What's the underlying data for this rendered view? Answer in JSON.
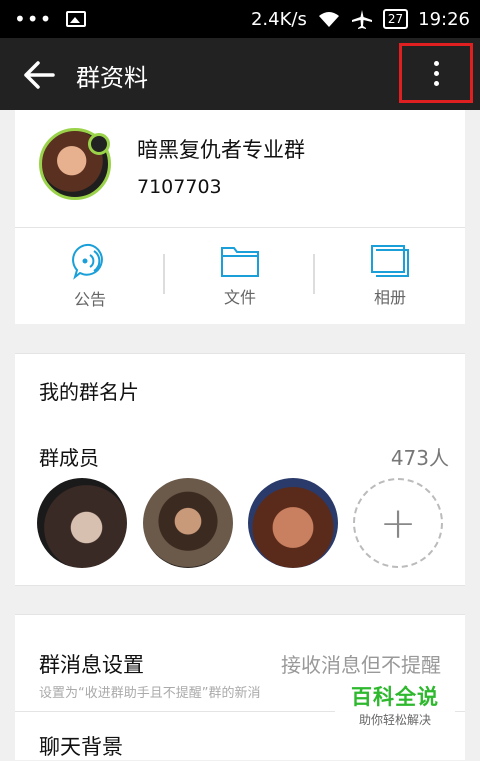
{
  "status_bar": {
    "net_speed": "2.4K/s",
    "battery": "27",
    "time": "19:26"
  },
  "title_bar": {
    "title": "群资料"
  },
  "group": {
    "name": "暗黑复仇者专业群",
    "id": "7107703"
  },
  "actions": [
    {
      "label": "公告",
      "icon": "announcement-icon"
    },
    {
      "label": "文件",
      "icon": "folder-icon"
    },
    {
      "label": "相册",
      "icon": "album-icon"
    }
  ],
  "my_card": {
    "label": "我的群名片"
  },
  "members": {
    "label": "群成员",
    "count": "473人"
  },
  "message_settings": {
    "label": "群消息设置",
    "value": "接收消息但不提醒",
    "description": "设置为“收进群助手且不提醒”群的新消"
  },
  "chat_background": {
    "label": "聊天背景"
  },
  "watermark": {
    "title": "百科全说",
    "subtitle": "助你轻松解决"
  },
  "colors": {
    "accent": "#1a9fd8",
    "highlight_box": "#e02020",
    "watermark_green": "#2eb82e"
  }
}
